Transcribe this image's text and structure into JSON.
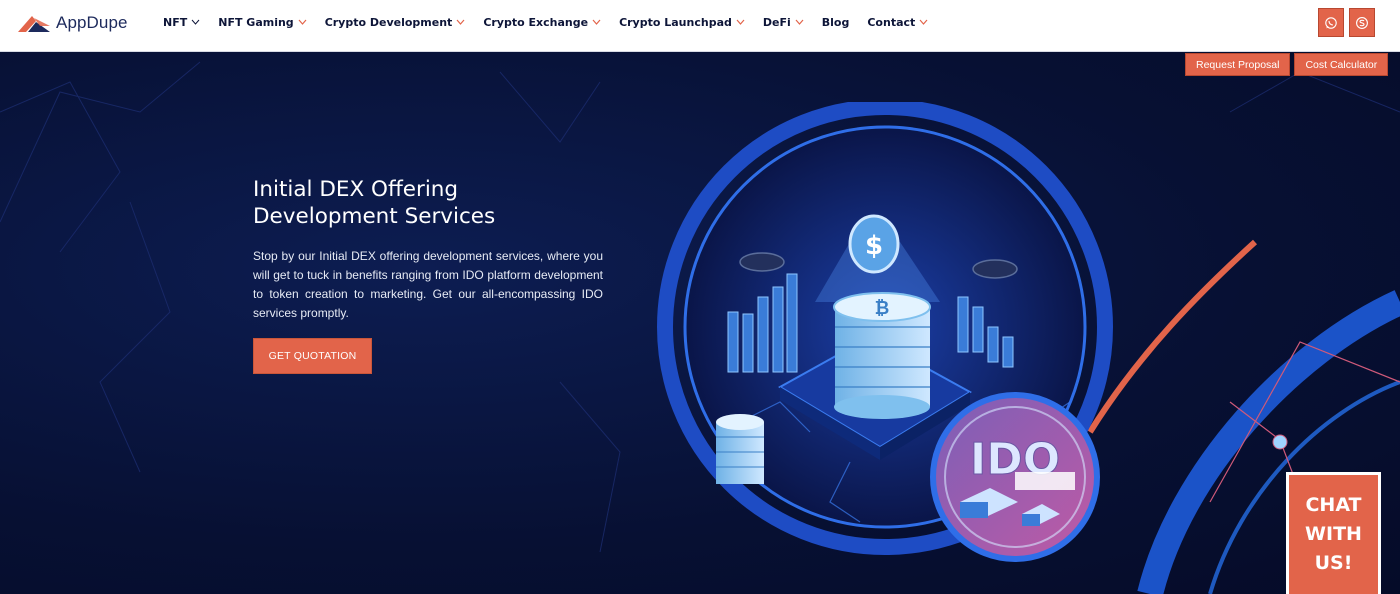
{
  "brand": {
    "name": "AppDupe"
  },
  "nav": {
    "items": [
      {
        "label": "NFT",
        "dropdown": true
      },
      {
        "label": "NFT Gaming",
        "dropdown": true
      },
      {
        "label": "Crypto Development",
        "dropdown": true
      },
      {
        "label": "Crypto Exchange",
        "dropdown": true
      },
      {
        "label": "Crypto Launchpad",
        "dropdown": true
      },
      {
        "label": "DeFi",
        "dropdown": true
      },
      {
        "label": "Blog",
        "dropdown": false
      },
      {
        "label": "Contact",
        "dropdown": true
      }
    ]
  },
  "contact_icons": [
    "whatsapp-icon",
    "skype-icon"
  ],
  "top_actions": {
    "request_proposal": "Request Proposal",
    "cost_calculator": "Cost Calculator"
  },
  "hero": {
    "title_line1": "Initial DEX Offering",
    "title_line2": "Development Services",
    "description": "Stop by our Initial DEX offering development services, where you will get to tuck in benefits ranging from IDO platform development to token creation to marketing. Get our all-encompassing IDO services promptly.",
    "cta": "GET QUOTATION"
  },
  "illustration": {
    "badge_text": "IDO"
  },
  "chat": {
    "line1": "CHAT",
    "line2": "WITH",
    "line3": "US!"
  },
  "colors": {
    "accent": "#e2644a",
    "navy": "#071033",
    "header_bg": "#ffffff",
    "nav_text": "#0d1538"
  }
}
